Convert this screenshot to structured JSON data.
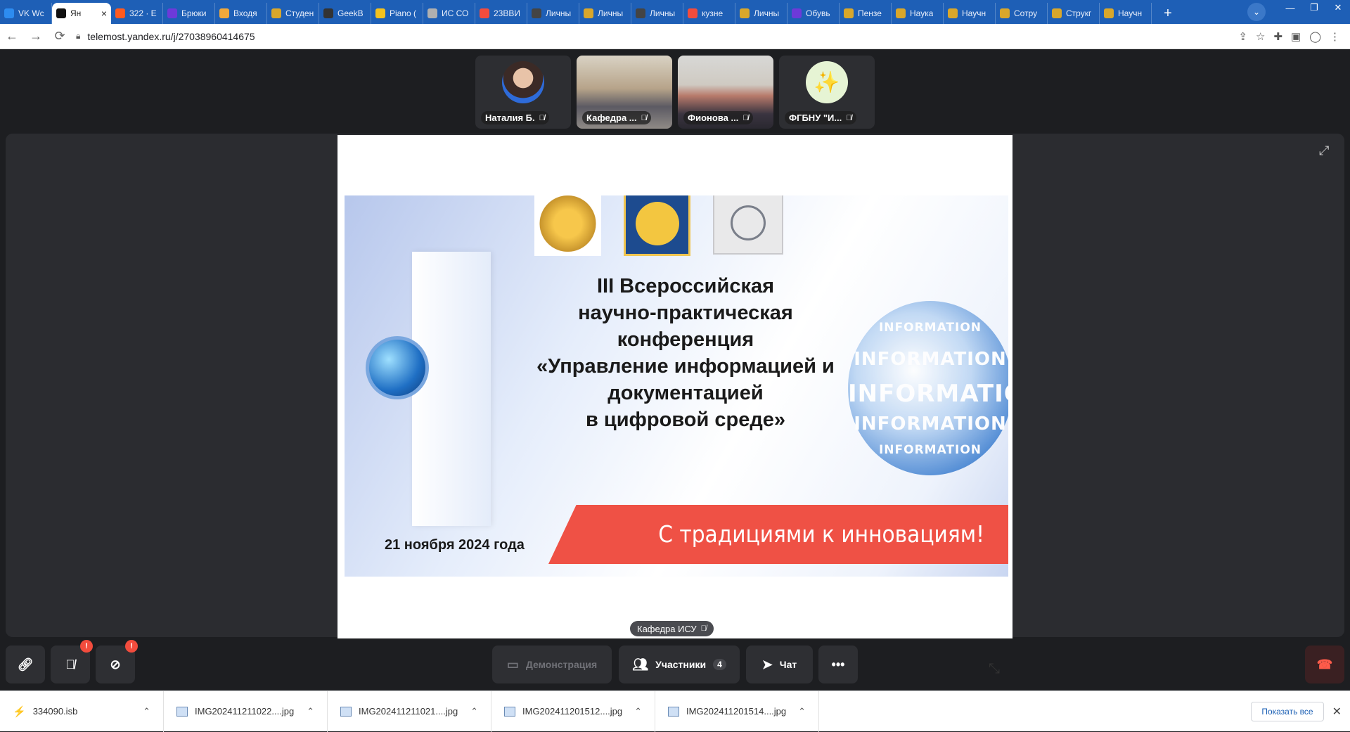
{
  "tabs": [
    {
      "title": "VK Wc",
      "color": "#2d8cf0",
      "active": false
    },
    {
      "title": "Ян",
      "color": "#111111",
      "active": true
    },
    {
      "title": "322 · Е",
      "color": "#ff5a1f",
      "active": false
    },
    {
      "title": "Брюки",
      "color": "#6d3ad9",
      "active": false
    },
    {
      "title": "Входя",
      "color": "#f2a93b",
      "active": false
    },
    {
      "title": "Студен",
      "color": "#d9a72b",
      "active": false
    },
    {
      "title": "GeekB",
      "color": "#333333",
      "active": false
    },
    {
      "title": "Piano (",
      "color": "#f4c21e",
      "active": false
    },
    {
      "title": "ИС СО",
      "color": "#b0b0b0",
      "active": false
    },
    {
      "title": "23ВВИ",
      "color": "#f24c3d",
      "active": false
    },
    {
      "title": "Личны",
      "color": "#444444",
      "active": false
    },
    {
      "title": "Личны",
      "color": "#d9a72b",
      "active": false
    },
    {
      "title": "Личны",
      "color": "#444444",
      "active": false
    },
    {
      "title": "кузне",
      "color": "#f24c3d",
      "active": false
    },
    {
      "title": "Личны",
      "color": "#d9a72b",
      "active": false
    },
    {
      "title": "Обувь",
      "color": "#6d3ad9",
      "active": false
    },
    {
      "title": "Пензе",
      "color": "#d9a72b",
      "active": false
    },
    {
      "title": "Наука",
      "color": "#d9a72b",
      "active": false
    },
    {
      "title": "Научн",
      "color": "#d9a72b",
      "active": false
    },
    {
      "title": "Сотру",
      "color": "#d9a72b",
      "active": false
    },
    {
      "title": "Струкг",
      "color": "#d9a72b",
      "active": false
    },
    {
      "title": "Научн",
      "color": "#d9a72b",
      "active": false
    }
  ],
  "address": {
    "url": "telemost.yandex.ru/j/27038960414675"
  },
  "participants": [
    {
      "name": "Наталия Б."
    },
    {
      "name": "Кафедра ..."
    },
    {
      "name": "Фионова ..."
    },
    {
      "name": "ФГБНУ \"И..."
    }
  ],
  "slide": {
    "title_lines": [
      "III Всероссийская",
      "научно-практическая",
      "конференция",
      "«Управление информацией и",
      "документацией",
      "в цифровой среде»"
    ],
    "date": "21 ноября 2024 года",
    "slogan": "С традициями к инновациям!",
    "sphere_words": [
      "INFORMATION",
      "INFORMATION",
      "INFORMATION",
      "INFORMATION",
      "INFORMATION"
    ]
  },
  "speaker": {
    "name": "Кафедра ИСУ"
  },
  "toolbar": {
    "demo_label": "Демонстрация",
    "participants_label": "Участники",
    "participants_count": "4",
    "chat_label": "Чат",
    "mic_badge": "!",
    "cam_badge": "!"
  },
  "downloads": [
    {
      "name": "334090.isb"
    },
    {
      "name": "IMG202411211022....jpg"
    },
    {
      "name": "IMG202411211021....jpg"
    },
    {
      "name": "IMG202411201512....jpg"
    },
    {
      "name": "IMG202411201514....jpg"
    }
  ],
  "downloads_show_all": "Показать все"
}
